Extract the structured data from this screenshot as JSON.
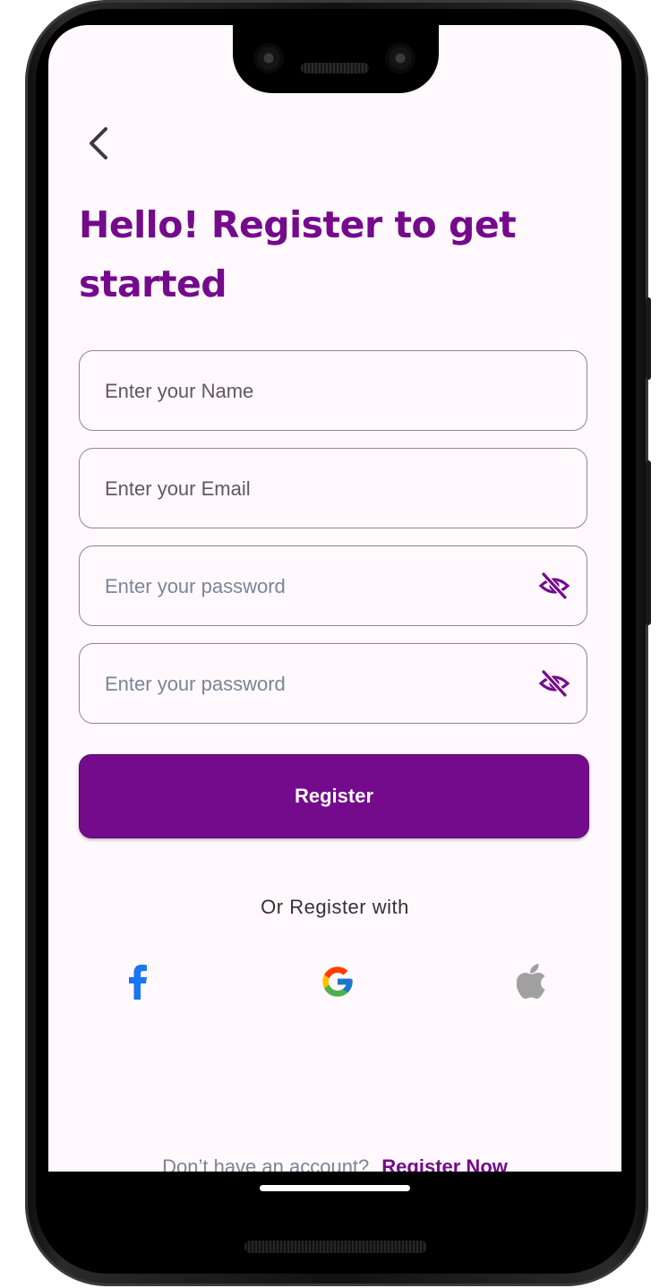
{
  "screen": {
    "title": "Hello! Register to get started",
    "back_icon": "chevron-left-icon",
    "accent_color": "#740a8c"
  },
  "form": {
    "name_placeholder": "Enter your Name",
    "email_placeholder": "Enter your Email",
    "password_placeholder": "Enter your password",
    "confirm_password_placeholder": "Enter your password",
    "visibility_icon": "eye-off-icon",
    "submit_label": "Register"
  },
  "social": {
    "caption": "Or Register with",
    "providers": [
      "facebook-icon",
      "google-icon",
      "apple-icon"
    ],
    "facebook_color": "#1877f2",
    "apple_color": "#a0a0a0"
  },
  "footer": {
    "question": "Don’t have an account?",
    "link": "Register Now"
  }
}
